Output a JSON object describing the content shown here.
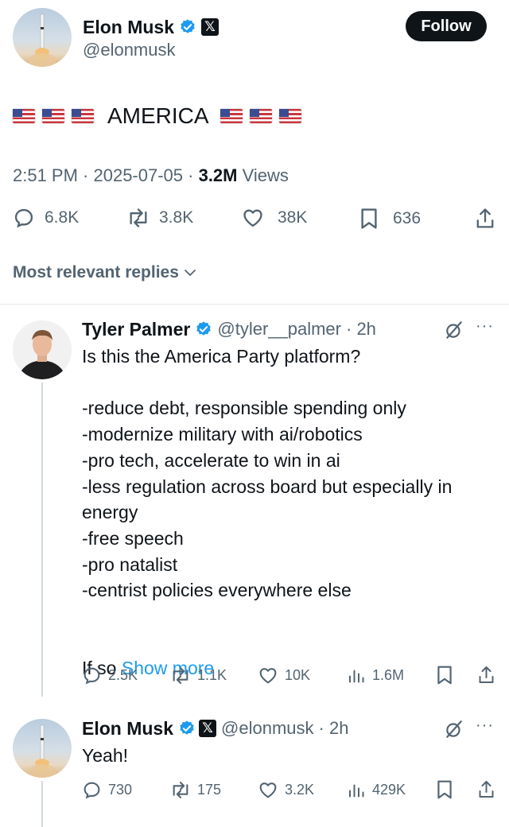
{
  "main_tweet": {
    "author_name": "Elon Musk",
    "author_handle": "@elonmusk",
    "follow_label": "Follow",
    "text": "AMERICA",
    "timestamp": "2:51 PM · 2025-07-05 · ",
    "views_count": "3.2M",
    "views_label": " Views",
    "stats": {
      "replies": "6.8K",
      "reposts": "3.8K",
      "likes": "38K",
      "bookmarks": "636"
    }
  },
  "replies_sort_label": "Most relevant replies",
  "reply_1": {
    "author_name": "Tyler Palmer",
    "author_handle": "@tyler__palmer",
    "time": "· 2h",
    "text": "Is this the America Party platform?\n\n-reduce debt, responsible spending only\n-modernize military with ai/robotics\n-pro tech, accelerate to win in ai\n-less regulation across board but especially in energy\n-free speech\n-pro natalist\n-centrist policies everywhere else",
    "text_tail": "If so ",
    "show_more": "Show more",
    "stats": {
      "replies": "2.5K",
      "reposts": "1.1K",
      "likes": "10K",
      "views": "1.6M"
    }
  },
  "reply_2": {
    "author_name": "Elon Musk",
    "author_handle": "@elonmusk",
    "time": "· 2h",
    "text": "Yeah!",
    "stats": {
      "replies": "730",
      "reposts": "175",
      "likes": "3.2K",
      "views": "429K"
    }
  },
  "colors": {
    "accent": "#1d9bf0",
    "text": "#0f1419",
    "muted": "#536471",
    "verified": "#1d9bf0"
  },
  "icons": [
    "rocket-avatar",
    "verified-badge-icon",
    "x-logo-icon",
    "us-flag-icon",
    "reply-icon",
    "repost-icon",
    "like-icon",
    "bookmark-icon",
    "share-icon",
    "views-icon",
    "grok-icon",
    "more-icon",
    "chevron-down-icon"
  ]
}
